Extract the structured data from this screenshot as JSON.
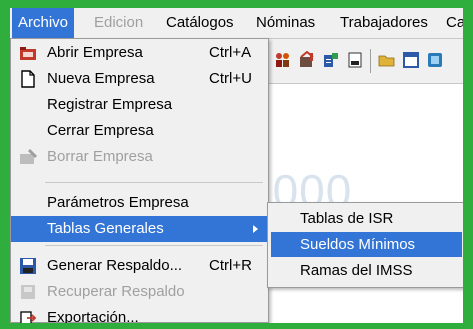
{
  "menubar": {
    "items": [
      {
        "label": "Archivo",
        "state": "active"
      },
      {
        "label": "Edicion",
        "state": "disabled"
      },
      {
        "label": "Catálogos",
        "state": "normal"
      },
      {
        "label": "Nóminas",
        "state": "normal"
      },
      {
        "label": "Trabajadores",
        "state": "normal"
      },
      {
        "label": "Ca",
        "state": "normal"
      }
    ]
  },
  "archivo_menu": {
    "items": [
      {
        "label": "Abrir Empresa",
        "shortcut": "Ctrl+A",
        "icon": "open-company-icon"
      },
      {
        "label": "Nueva Empresa",
        "shortcut": "Ctrl+U",
        "icon": "new-document-icon"
      },
      {
        "label": "Registrar Empresa"
      },
      {
        "label": "Cerrar Empresa"
      },
      {
        "label": "Borrar Empresa",
        "icon": "delete-company-icon",
        "disabled": true
      },
      {
        "label": "Parámetros Empresa"
      },
      {
        "label": "Tablas Generales",
        "highlighted": true
      },
      {
        "label": "Generar Respaldo...",
        "shortcut": "Ctrl+R",
        "icon": "save-disk-icon"
      },
      {
        "label": "Recuperar Respaldo",
        "icon": "restore-icon",
        "disabled": true
      },
      {
        "label": "Exportación...",
        "icon": "export-icon"
      }
    ]
  },
  "tablas_submenu": {
    "items": [
      {
        "label": "Tablas de ISR"
      },
      {
        "label": "Sueldos Mínimos",
        "highlighted": true
      },
      {
        "label": "Ramas del IMSS"
      }
    ]
  },
  "watermark": {
    "text": "2000"
  },
  "colors": {
    "highlight": "#3375d6",
    "frame_border": "#2fae3e",
    "menu_bg": "#f0f0f0",
    "disabled_text": "#a0a0a0"
  }
}
